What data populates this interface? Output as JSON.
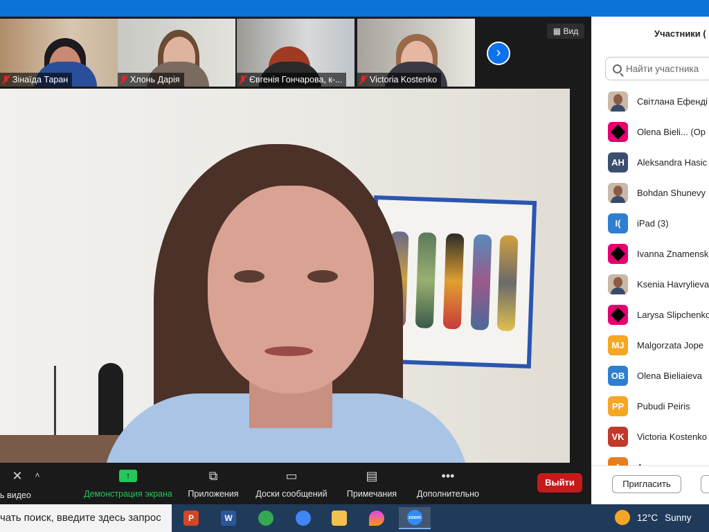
{
  "gallery": {
    "tiles": [
      {
        "name": "Зінаїда Таран",
        "muted": true
      },
      {
        "name": "Хлонь Дарія",
        "muted": true
      },
      {
        "name": "Євгенія Гончарова, к-...",
        "muted": true
      },
      {
        "name": "Victoria Kostenko",
        "muted": true
      }
    ],
    "view_label": "Вид"
  },
  "toolbar": {
    "video_label": "ь видео",
    "share_label": "Демонстрация экрана",
    "apps_label": "Приложения",
    "whiteboards_label": "Доски сообщений",
    "notes_label": "Примечания",
    "more_label": "Дополнительно",
    "exit_label": "Выйти"
  },
  "participants": {
    "title": "Участники (",
    "search_placeholder": "Найти участника",
    "items": [
      {
        "name": "Світлана Ефенді",
        "avatar_type": "photo",
        "initials": "",
        "color": "#c9b8a8"
      },
      {
        "name": "Olena Bieli...   (Op",
        "avatar_type": "logo",
        "initials": "",
        "color": "#e6006f"
      },
      {
        "name": "Aleksandra Hasic",
        "avatar_type": "initials",
        "initials": "AH",
        "color": "#3c4e6e"
      },
      {
        "name": "Bohdan Shunevy",
        "avatar_type": "photo",
        "initials": "",
        "color": "#c9b8a8"
      },
      {
        "name": "iPad (3)",
        "avatar_type": "initials",
        "initials": "I(",
        "color": "#2f7fd0"
      },
      {
        "name": "Ivanna Znamensk",
        "avatar_type": "logo",
        "initials": "",
        "color": "#e6006f"
      },
      {
        "name": "Ksenia Havrylieva",
        "avatar_type": "photo",
        "initials": "",
        "color": "#c9b8a8"
      },
      {
        "name": "Larysa Slipchenko",
        "avatar_type": "logo",
        "initials": "",
        "color": "#e6006f"
      },
      {
        "name": "Malgorzata Jope",
        "avatar_type": "initials",
        "initials": "MJ",
        "color": "#f5a623"
      },
      {
        "name": "Olena Bieliaieva",
        "avatar_type": "initials",
        "initials": "OB",
        "color": "#2f7fd0"
      },
      {
        "name": "Pubudi Peiris",
        "avatar_type": "initials",
        "initials": "PP",
        "color": "#f5a623"
      },
      {
        "name": "Victoria Kostenko",
        "avatar_type": "initials",
        "initials": "VK",
        "color": "#c0392b"
      },
      {
        "name": "А...",
        "avatar_type": "initials",
        "initials": "A",
        "color": "#e67e22"
      }
    ],
    "invite_label": "Пригласить"
  },
  "taskbar": {
    "search_text": "чать поиск, введите здесь запрос",
    "weather_temp": "12°C",
    "weather_text": "Sunny"
  }
}
